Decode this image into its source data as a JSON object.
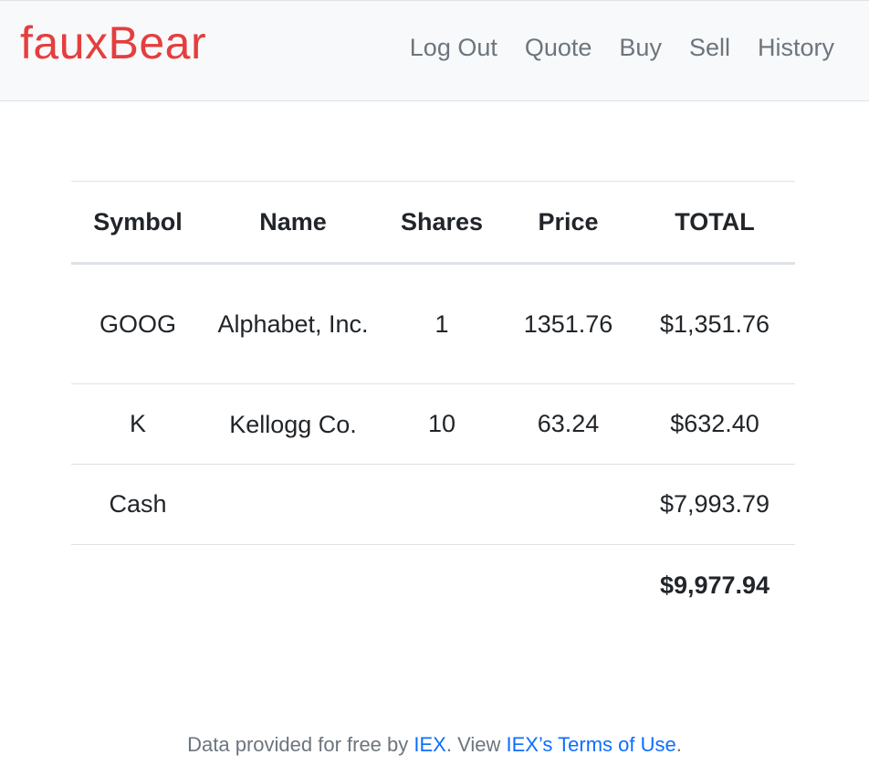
{
  "brand": "fauxBear",
  "nav": {
    "log_out": "Log Out",
    "quote": "Quote",
    "buy": "Buy",
    "sell": "Sell",
    "history": "History"
  },
  "table": {
    "headers": {
      "symbol": "Symbol",
      "name": "Name",
      "shares": "Shares",
      "price": "Price",
      "total": "TOTAL"
    },
    "rows": [
      {
        "symbol": "GOOG",
        "name": "Alphabet, Inc.",
        "shares": "1",
        "price": "1351.76",
        "total": "$1,351.76"
      },
      {
        "symbol": "K",
        "name": "Kellogg Co.",
        "shares": "10",
        "price": "63.24",
        "total": "$632.40"
      }
    ],
    "cash": {
      "label": "Cash",
      "total": "$7,993.79"
    },
    "grand_total": "$9,977.94"
  },
  "footer": {
    "prefix": "Data provided for free by ",
    "iex_link": "IEX",
    "middle": ". View ",
    "terms_link": "IEX’s Terms of Use",
    "suffix": "."
  },
  "colors": {
    "brand": "#e53e3e",
    "link": "#0d6efd",
    "nav_text": "#6c757d",
    "navbar_bg": "#f8f9fa"
  }
}
